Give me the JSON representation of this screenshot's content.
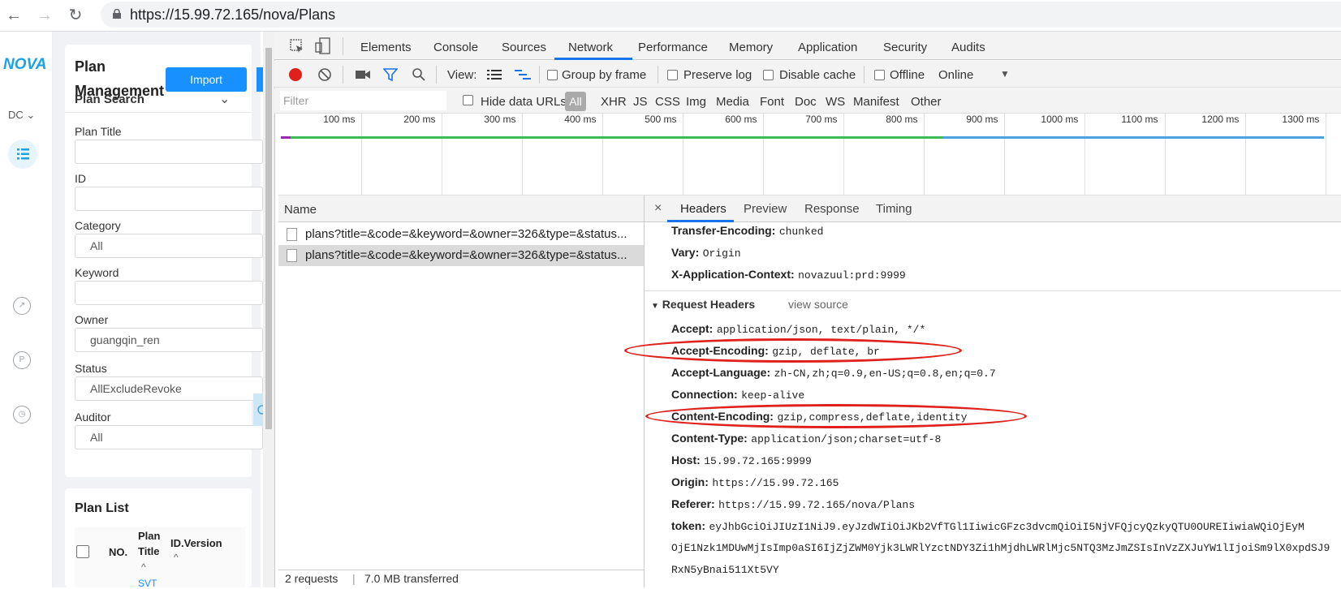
{
  "browser": {
    "url": "https://15.99.72.165/nova/Plans"
  },
  "app": {
    "logo": "NOVA",
    "dc_label": "DC",
    "page_title_line1": "Plan",
    "page_title_line2": "Management",
    "import_label": "Import",
    "search_title": "Plan Search",
    "fields": [
      {
        "label": "Plan Title",
        "value": ""
      },
      {
        "label": "ID",
        "value": ""
      },
      {
        "label": "Category",
        "value": "All"
      },
      {
        "label": "Keyword",
        "value": ""
      },
      {
        "label": "Owner",
        "value": "guangqin_ren"
      },
      {
        "label": "Status",
        "value": "AllExcludeRevoke"
      },
      {
        "label": "Auditor",
        "value": "All"
      }
    ],
    "list_title": "Plan List",
    "columns": [
      "NO.",
      "Plan Title",
      "ID.Version"
    ],
    "partial_cell": "SVT"
  },
  "devtools": {
    "tabs": [
      "Elements",
      "Console",
      "Sources",
      "Network",
      "Performance",
      "Memory",
      "Application",
      "Security",
      "Audits"
    ],
    "active_tab": "Network",
    "toolbar": {
      "view_label": "View:",
      "group_by_frame": "Group by frame",
      "preserve_log": "Preserve log",
      "disable_cache": "Disable cache",
      "offline": "Offline",
      "throttle": "Online"
    },
    "filter": {
      "placeholder": "Filter",
      "hide_data_urls": "Hide data URLs",
      "types": [
        "All",
        "XHR",
        "JS",
        "CSS",
        "Img",
        "Media",
        "Font",
        "Doc",
        "WS",
        "Manifest",
        "Other"
      ]
    },
    "timeline_ticks": [
      "100 ms",
      "200 ms",
      "300 ms",
      "400 ms",
      "500 ms",
      "600 ms",
      "700 ms",
      "800 ms",
      "900 ms",
      "1000 ms",
      "1100 ms",
      "1200 ms",
      "1300 ms"
    ],
    "requests": {
      "column": "Name",
      "rows": [
        "plans?title=&code=&keyword=&owner=326&type=&status...",
        "plans?title=&code=&keyword=&owner=326&type=&status..."
      ],
      "summary": "2 requests",
      "transferred": "7.0 MB transferred"
    },
    "details": {
      "tabs": [
        "Headers",
        "Preview",
        "Response",
        "Timing"
      ],
      "response_headers": [
        {
          "k": "Transfer-Encoding:",
          "v": "chunked"
        },
        {
          "k": "Vary:",
          "v": "Origin"
        },
        {
          "k": "X-Application-Context:",
          "v": "novazuul:prd:9999"
        }
      ],
      "request_section": "Request Headers",
      "view_source": "view source",
      "request_headers": [
        {
          "k": "Accept:",
          "v": "application/json, text/plain, */*"
        },
        {
          "k": "Accept-Encoding:",
          "v": "gzip, deflate, br"
        },
        {
          "k": "Accept-Language:",
          "v": "zh-CN,zh;q=0.9,en-US;q=0.8,en;q=0.7"
        },
        {
          "k": "Connection:",
          "v": "keep-alive"
        },
        {
          "k": "Content-Encoding:",
          "v": "gzip,compress,deflate,identity"
        },
        {
          "k": "Content-Type:",
          "v": "application/json;charset=utf-8"
        },
        {
          "k": "Host:",
          "v": "15.99.72.165:9999"
        },
        {
          "k": "Origin:",
          "v": "https://15.99.72.165"
        },
        {
          "k": "Referer:",
          "v": "https://15.99.72.165/nova/Plans"
        },
        {
          "k": "token:",
          "v": "eyJhbGciOiJIUzI1NiJ9.eyJzdWIiOiJKb2VfTGl1IiwicGFzc3dvcmQiOiI5NjVFQjcyQzkyQTU0OUREIiwiaWQiOjEyM"
        }
      ],
      "token_line2": "OjE1Nzk1MDUwMjIsImp0aSI6IjZjZWM0Yjk3LWRlYzctNDY3Zi1hMjdhLWRlMjc5NTQ3MzJmZSIsInVzZXJuYW1lIjoiSm9lX0xpdSJ9",
      "token_line3": "RxN5yBnai511Xt5VY"
    }
  },
  "colors": {
    "accent": "#1890ff",
    "highlight": "#e0211b",
    "tab_underline": "#1a73e8"
  }
}
